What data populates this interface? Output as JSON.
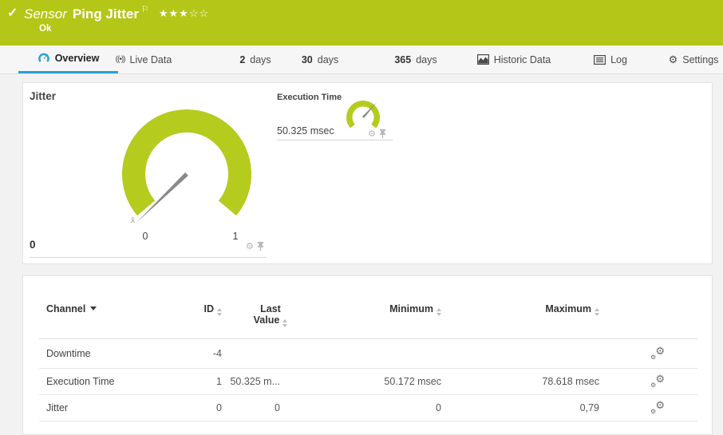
{
  "header": {
    "check_icon": "✓",
    "type_label": "Sensor",
    "title": "Ping Jitter",
    "flag_icon": "⚐",
    "rating_filled": "★★★",
    "rating_empty": "☆☆",
    "status": "Ok"
  },
  "tabs": {
    "overview": "Overview",
    "live_data": "Live Data",
    "live_data_icon": "((•))",
    "days2_num": "2",
    "days2_label": "days",
    "days30_num": "30",
    "days30_label": "days",
    "days365_num": "365",
    "days365_label": "days",
    "historic": "Historic Data",
    "log": "Log",
    "settings": "Settings",
    "settings_icon": "⚙"
  },
  "gauges": {
    "jitter": {
      "title": "Jitter",
      "scale_min": "0",
      "scale_max": "1",
      "mean_marker": "x̄",
      "value": "0",
      "gear_icon": "⚙"
    },
    "execution_time": {
      "title": "Execution Time",
      "value": "50.325 msec",
      "gear_icon": "⚙"
    }
  },
  "table": {
    "headers": {
      "channel": "Channel",
      "id": "ID",
      "last_line1": "Last",
      "last_line2": "Value",
      "minimum": "Minimum",
      "maximum": "Maximum"
    },
    "gear_icon": "⚙",
    "rows": [
      {
        "channel": "Downtime",
        "id": "-4",
        "last": "",
        "min": "",
        "max": ""
      },
      {
        "channel": "Execution Time",
        "id": "1",
        "last": "50.325 m...",
        "min": "50.172 msec",
        "max": "78.618 msec"
      },
      {
        "channel": "Jitter",
        "id": "0",
        "last": "0",
        "min": "0",
        "max": "0,79"
      }
    ]
  },
  "colors": {
    "brand_green": "#b4c617",
    "gauge_green": "#b5cb1e",
    "accent_blue": "#29a1d8"
  }
}
